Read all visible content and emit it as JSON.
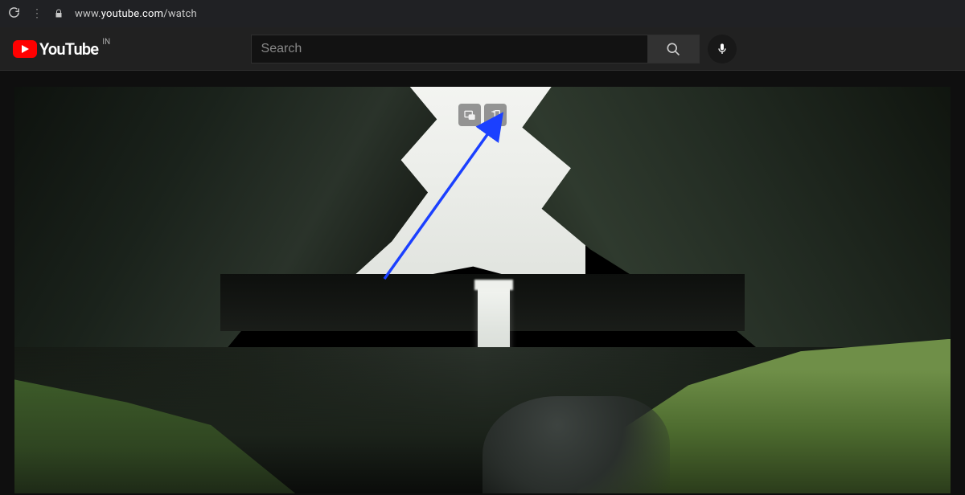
{
  "browser": {
    "url_prefix": "www.",
    "url_domain": "youtube.com",
    "url_path": "/watch"
  },
  "header": {
    "brand": "YouTube",
    "country_code": "IN",
    "search_placeholder": "Search"
  },
  "extension_controls": {
    "btn1_icon": "pip-icon",
    "btn2_icon": "fit-icon"
  },
  "colors": {
    "brand_red": "#ff0000",
    "bg": "#0f0f0f",
    "header_bg": "#212121",
    "arrow": "#1b40ff"
  }
}
